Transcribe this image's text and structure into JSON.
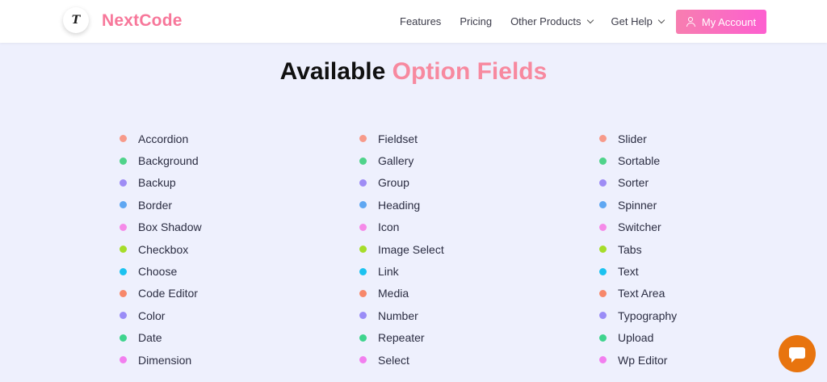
{
  "brand": {
    "logo_letter": "T",
    "name": "NextCode"
  },
  "nav": {
    "items": [
      {
        "label": "Features",
        "dropdown": false
      },
      {
        "label": "Pricing",
        "dropdown": false
      },
      {
        "label": "Other Products",
        "dropdown": true
      },
      {
        "label": "Get Help",
        "dropdown": true
      }
    ],
    "account_label": "My Account"
  },
  "section": {
    "title_part1": "Available",
    "title_part2": "Option Fields"
  },
  "colors": {
    "accent": "#f7779a",
    "dot_palette": [
      "#f79a8a",
      "#4fd38a",
      "#9e8cf5",
      "#5fa7f2",
      "#f58ae8",
      "#a6dd2a",
      "#1bc2f0",
      "#f7876a",
      "#9a8cf7",
      "#3fd48e",
      "#f27fef"
    ],
    "chat": "#e8740e"
  },
  "fields": {
    "columns": [
      [
        "Accordion",
        "Background",
        "Backup",
        "Border",
        "Box Shadow",
        "Checkbox",
        "Choose",
        "Code Editor",
        "Color",
        "Date",
        "Dimension"
      ],
      [
        "Fieldset",
        "Gallery",
        "Group",
        "Heading",
        "Icon",
        "Image Select",
        "Link",
        "Media",
        "Number",
        "Repeater",
        "Select"
      ],
      [
        "Slider",
        "Sortable",
        "Sorter",
        "Spinner",
        "Switcher",
        "Tabs",
        "Text",
        "Text Area",
        "Typography",
        "Upload",
        "Wp Editor"
      ]
    ]
  },
  "chat": {
    "icon": "chat-bubble-icon"
  }
}
